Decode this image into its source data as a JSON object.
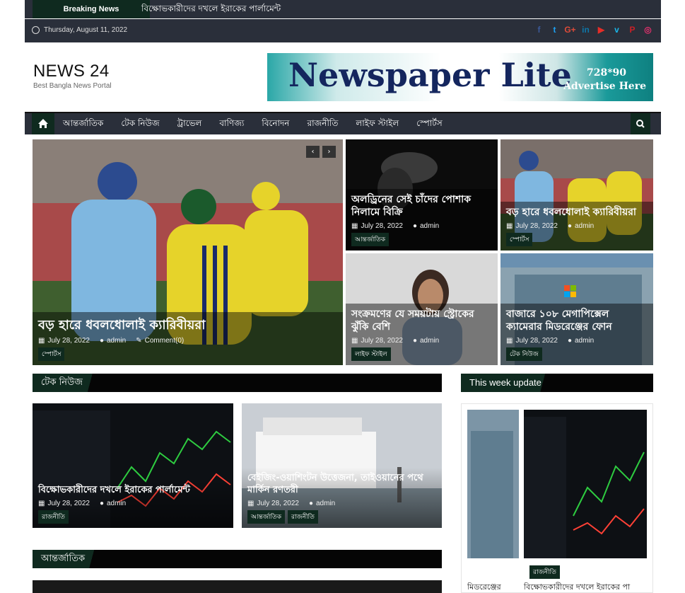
{
  "topbar": {
    "breaking_label": "Breaking News",
    "breaking_text": "বিক্ষোভকারীদের দখলে ইরাকের পার্লামেন্ট",
    "date": "Thursday, August 11, 2022",
    "social_icons": [
      "facebook-icon",
      "twitter-icon",
      "google-plus-icon",
      "linkedin-icon",
      "youtube-icon",
      "vimeo-icon",
      "pinterest-icon",
      "instagram-icon"
    ],
    "social_glyphs": [
      "f",
      "t",
      "G+",
      "in",
      "▶",
      "v",
      "P",
      "◎"
    ]
  },
  "header": {
    "site_title": "NEWS 24",
    "site_desc": "Best Bangla News Portal",
    "ad_title": "Newspaper Lite",
    "ad_size": "728*90",
    "ad_cta": "Advertise Here"
  },
  "nav": {
    "items": [
      "আন্তর্জাতিক",
      "টেক নিউজ",
      "ট্রাভেল",
      "বাণিজ্য",
      "বিনোদন",
      "রাজনীতি",
      "লাইফ স্টাইল",
      "স্পোর্টস"
    ]
  },
  "hero": {
    "main": {
      "title": "বড় হারে ধবলধোলাই ক্যারিবীয়রা",
      "date": "July 28, 2022",
      "author": "admin",
      "comments": "Comment(0)",
      "category": "স্পোর্টস"
    },
    "tiles": [
      {
        "title": "অলড্রিনের সেই চাঁদের পোশাক নিলামে বিক্রি",
        "date": "July 28, 2022",
        "author": "admin",
        "category": "আন্তর্জাতিক"
      },
      {
        "title": "বড় হারে ধবলধোলাই ক্যারিবীয়রা",
        "date": "July 28, 2022",
        "author": "admin",
        "category": "স্পোর্টস"
      },
      {
        "title": "সংক্রমণের যে সময়টায় স্ট্রোকের ঝুঁকি বেশি",
        "date": "July 28, 2022",
        "author": "admin",
        "category": "লাইফ স্টাইল"
      },
      {
        "title": "বাজারে ১০৮ মেগাপিক্সেল ক্যামেরার মিডরেঞ্জের ফোন",
        "date": "July 28, 2022",
        "author": "admin",
        "category": "টেক নিউজ"
      }
    ]
  },
  "tech_section": {
    "heading": "টেক নিউজ",
    "cards": [
      {
        "title": "বিক্ষোভকারীদের দখলে ইরাকের পার্লামেন্ট",
        "date": "July 28, 2022",
        "author": "admin",
        "categories": [
          "রাজনীতি"
        ]
      },
      {
        "title": "বেইজিং-ওয়াশিংটন উত্তেজনা, তাইওয়ানের পথে মার্কিন রণতরী",
        "date": "July 28, 2022",
        "author": "admin",
        "categories": [
          "আন্তর্জাতিক",
          "রাজনীতি"
        ]
      }
    ]
  },
  "intl_section": {
    "heading": "আন্তর্জাতিক"
  },
  "sidebar": {
    "heading": "This week update",
    "items": [
      {
        "title": "মিডরেঞ্জের",
        "category": ""
      },
      {
        "title": "বিক্ষোভকারীদের দখলে ইরাকের পা",
        "category": "রাজনীতি"
      }
    ]
  }
}
